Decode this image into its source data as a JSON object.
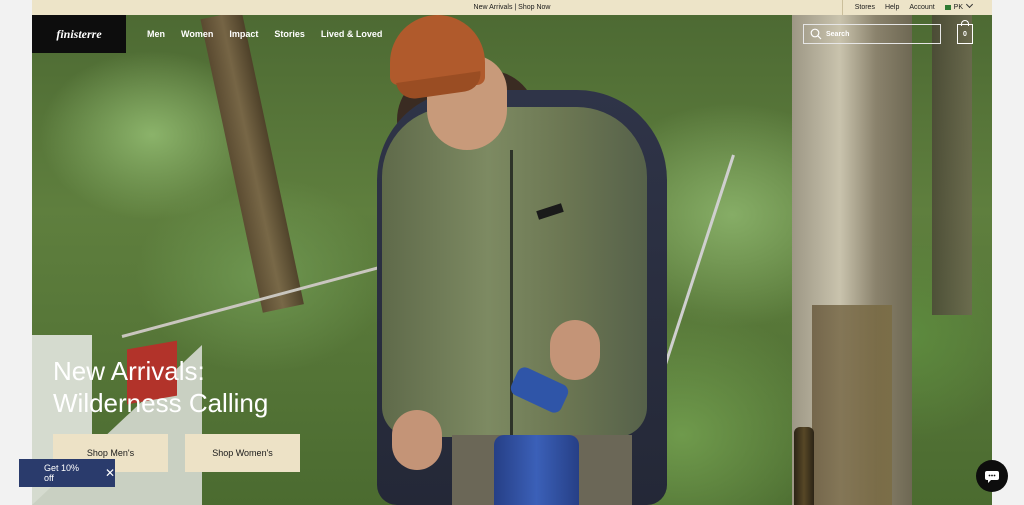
{
  "announcement": {
    "text": "New Arrivals | Shop Now"
  },
  "utility_nav": {
    "items": [
      "Stores",
      "Help",
      "Account"
    ],
    "region": "PK"
  },
  "brand": {
    "logo_text": "finisterre"
  },
  "main_nav": {
    "items": [
      "Men",
      "Women",
      "Impact",
      "Stories",
      "Lived & Loved"
    ]
  },
  "search": {
    "placeholder": "Search"
  },
  "cart": {
    "count": "0"
  },
  "hero": {
    "headline_line1": "New Arrivals:",
    "headline_line2": "Wilderness Calling",
    "cta_men": "Shop Men's",
    "cta_women": "Shop Women's"
  },
  "promo": {
    "label": "Get 10% off",
    "close": "✕"
  },
  "colors": {
    "announcement_bg": "#ede4c8",
    "cta_bg": "#ede2c6",
    "promo_bg": "#2a3b6c",
    "logo_bg": "#0d0d0d"
  },
  "icons": [
    "search-icon",
    "bag-icon",
    "chevron-down-icon",
    "flag-icon",
    "chat-icon",
    "close-icon"
  ]
}
